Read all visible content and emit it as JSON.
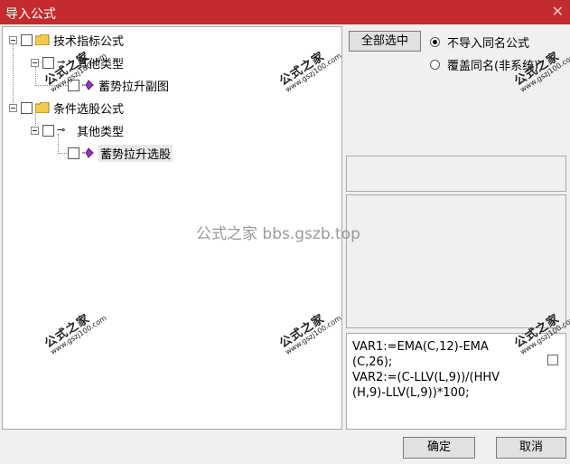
{
  "window": {
    "title": "导入公式",
    "close_glyph": "✕"
  },
  "tree": {
    "nodes": [
      {
        "label": "技术指标公式"
      },
      {
        "label": "其他类型"
      },
      {
        "label": "蓄势拉升副图"
      },
      {
        "label": "条件选股公式"
      },
      {
        "label": "其他类型"
      },
      {
        "label": "蓄势拉升选股"
      }
    ]
  },
  "options": {
    "select_all_label": "全部选中",
    "radio_skip_label": "不导入同名公式",
    "radio_overwrite_label": "覆盖同名(非系统)",
    "selected_radio": "skip"
  },
  "code": {
    "lines": [
      "VAR1:=EMA(C,12)-EMA",
      "(C,26);",
      "VAR2:=(C-LLV(L,9))/(HHV",
      "(H,9)-LLV(L,9))*100;"
    ]
  },
  "buttons": {
    "ok_label": "确定",
    "cancel_label": "取消"
  },
  "watermark": {
    "center_text": "公式之家 bbs.gszb.top",
    "stamp_cn": "公式之家",
    "stamp_url": "www.gszj100.com"
  },
  "colors": {
    "titlebar": "#c42b2e",
    "folder": "#f2c94c",
    "gem": "#9b2fc4"
  }
}
